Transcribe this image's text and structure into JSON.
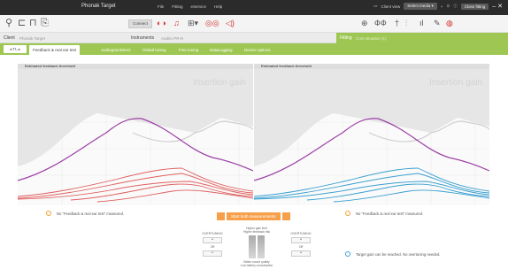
{
  "window": {
    "title": "Phonak Target",
    "menu": [
      "File",
      "Fitting",
      "eService",
      "Help"
    ],
    "client_view": "Client view",
    "select_media": "Select media",
    "close_fitting": "Close fitting"
  },
  "toolbar": {
    "connect_label": "Connect"
  },
  "clientbar": {
    "client_label": "Client",
    "client_value": "Phonak Target",
    "instruments_label": "Instruments",
    "instruments_value": "Audéo PR-R",
    "fitting_label": "Fitting",
    "fitting_value": "Core situation (1)"
  },
  "tabs": {
    "nav_label": "TL",
    "items": [
      "Feedback & real ear test",
      "AudiogramDirect",
      "Global tuning",
      "Fine tuning",
      "DataLogging",
      "Device options"
    ]
  },
  "panels": [
    {
      "header": "Estimated feedback threshold",
      "watermark": "Insertion gain",
      "curve_color": "#e06060"
    },
    {
      "header": "Estimated feedback threshold",
      "watermark": "Insertion gain",
      "curve_color": "#3aa0d0"
    }
  ],
  "notes": {
    "left": "No \"Feedback & real ear test\" measured.",
    "right": "No \"Feedback & real ear test\" measured.",
    "target": "Target gain can be reached. No overtuning needed."
  },
  "measure_button": "Start both measurements",
  "gain_control": {
    "left_title": "OVERTUNING",
    "right_title": "OVERTUNING",
    "off_label": "Off",
    "top_text": "Higher gain limit\nHigher feedback risk",
    "bottom_text": "Better sound quality\nLow battery consumption"
  },
  "colors": {
    "accent_green": "#9dc752",
    "orange": "#f6a04b",
    "purple": "#9b3fa5",
    "red": "#e06060",
    "blue": "#3aa0d0"
  }
}
